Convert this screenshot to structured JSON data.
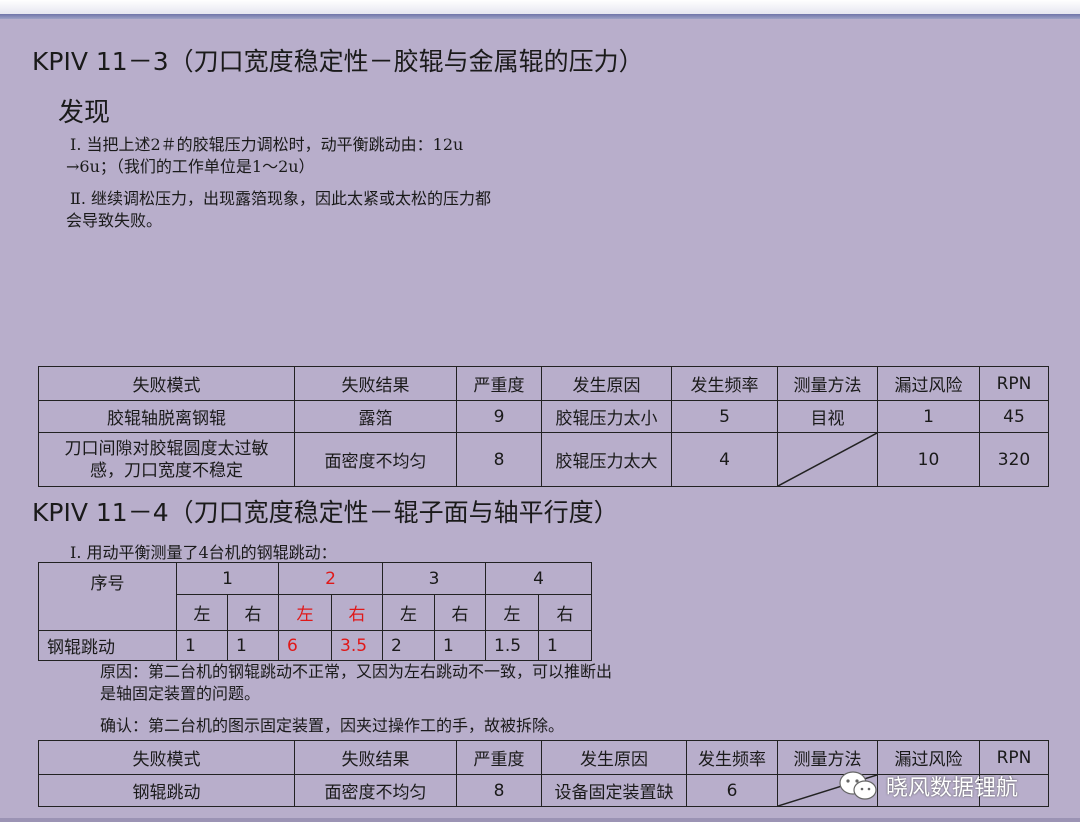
{
  "section1": {
    "title": "KPIV 11－3（刀口宽度稳定性－胶辊与金属辊的压力）",
    "subhead": "发现",
    "line1": "Ⅰ. 当把上述2＃的胶辊压力调松时，动平衡跳动由：12u",
    "line2": "→6u；（我们的工作单位是1～2u）",
    "line3": "Ⅱ. 继续调松压力，出现露箔现象，因此太紧或太松的压力都",
    "line4": "会导致失败。"
  },
  "fmea_headers": [
    "失败模式",
    "失败结果",
    "严重度",
    "发生原因",
    "发生频率",
    "测量方法",
    "漏过风险",
    "RPN"
  ],
  "fmea1": [
    [
      "胶辊轴脱离钢辊",
      "露箔",
      "9",
      "胶辊压力太小",
      "5",
      "目视",
      "1",
      "45"
    ],
    [
      "刀口间隙对胶辊圆度太过敏感，刀口宽度不稳定",
      "面密度不均匀",
      "8",
      "胶辊压力太大",
      "4",
      "",
      "10",
      "320"
    ]
  ],
  "section2": {
    "title": "KPIV 11－4（刀口宽度稳定性－辊子面与轴平行度）",
    "intro": "Ⅰ. 用动平衡测量了4台机的钢辊跳动：",
    "reason1": "原因：第二台机的钢辊跳动不正常，又因为左右跳动不一致，可以推断出",
    "reason2": "是轴固定装置的问题。",
    "confirm": "确认：第二台机的图示固定装置，因夹过操作工的手，故被拆除。"
  },
  "runout": {
    "header_label": "序号",
    "machines": [
      "1",
      "2",
      "3",
      "4"
    ],
    "sides": [
      "左",
      "右",
      "左",
      "右",
      "左",
      "右",
      "左",
      "右"
    ],
    "row_label": "钢辊跳动",
    "values": [
      "1",
      "1",
      "6",
      "3.5",
      "2",
      "1",
      "1.5",
      "1"
    ],
    "highlight_color": "#e01818"
  },
  "fmea2": [
    [
      "钢辊跳动",
      "面密度不均匀",
      "8",
      "设备固定装置缺",
      "6",
      "",
      "",
      ""
    ]
  ],
  "watermark": {
    "text": "晓风数据锂航",
    "icon": "wechat-icon"
  }
}
